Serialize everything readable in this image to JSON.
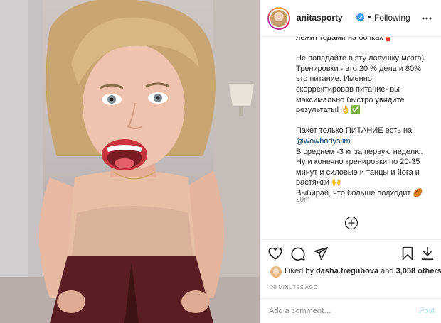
{
  "post": {
    "username": "anitasporty",
    "verified": true,
    "separator": "•",
    "follow_state": "Following",
    "caption_lines": [
      "лежит годами на бочках🍟",
      "",
      "Не попадайте в эту ловушку мозга)",
      "Тренировки - это 20 % дела и 80%",
      "это питание. Именно",
      "скорректировав питание- вы",
      "максимально быстро увидите",
      "результаты! 👌✅",
      "",
      "Пакет только ПИТАНИЕ есть на"
    ],
    "mention": "@wowbodyslim",
    "mention_suffix": ".",
    "caption_lines_after": [
      "В среднем -3 кг за первую неделю.",
      "Ну и конечно тренировки по 20-35",
      "минут и силовые и танцы и йога и",
      "растяжки 🙌",
      "Выбирай, что больше подходит 🏉"
    ],
    "time_ago": "20m"
  },
  "engagement": {
    "liked_prefix": "Liked by",
    "liked_user": "dasha.tregubova",
    "and_text": "and",
    "others": "3,058 others",
    "timestamp": "20 MINUTES AGO"
  },
  "comment": {
    "placeholder": "Add a comment…",
    "post_label": "Post"
  },
  "icons": {
    "more": "more-horizontal-icon",
    "load_more": "plus-circle-icon",
    "like": "heart-icon",
    "comment": "comment-icon",
    "share": "paper-plane-icon",
    "save": "bookmark-icon",
    "download": "download-icon"
  },
  "colors": {
    "verified": "#3897f0",
    "mention": "#00376b",
    "post_disabled": "#b2dffc",
    "muted": "#8e8e8e"
  }
}
